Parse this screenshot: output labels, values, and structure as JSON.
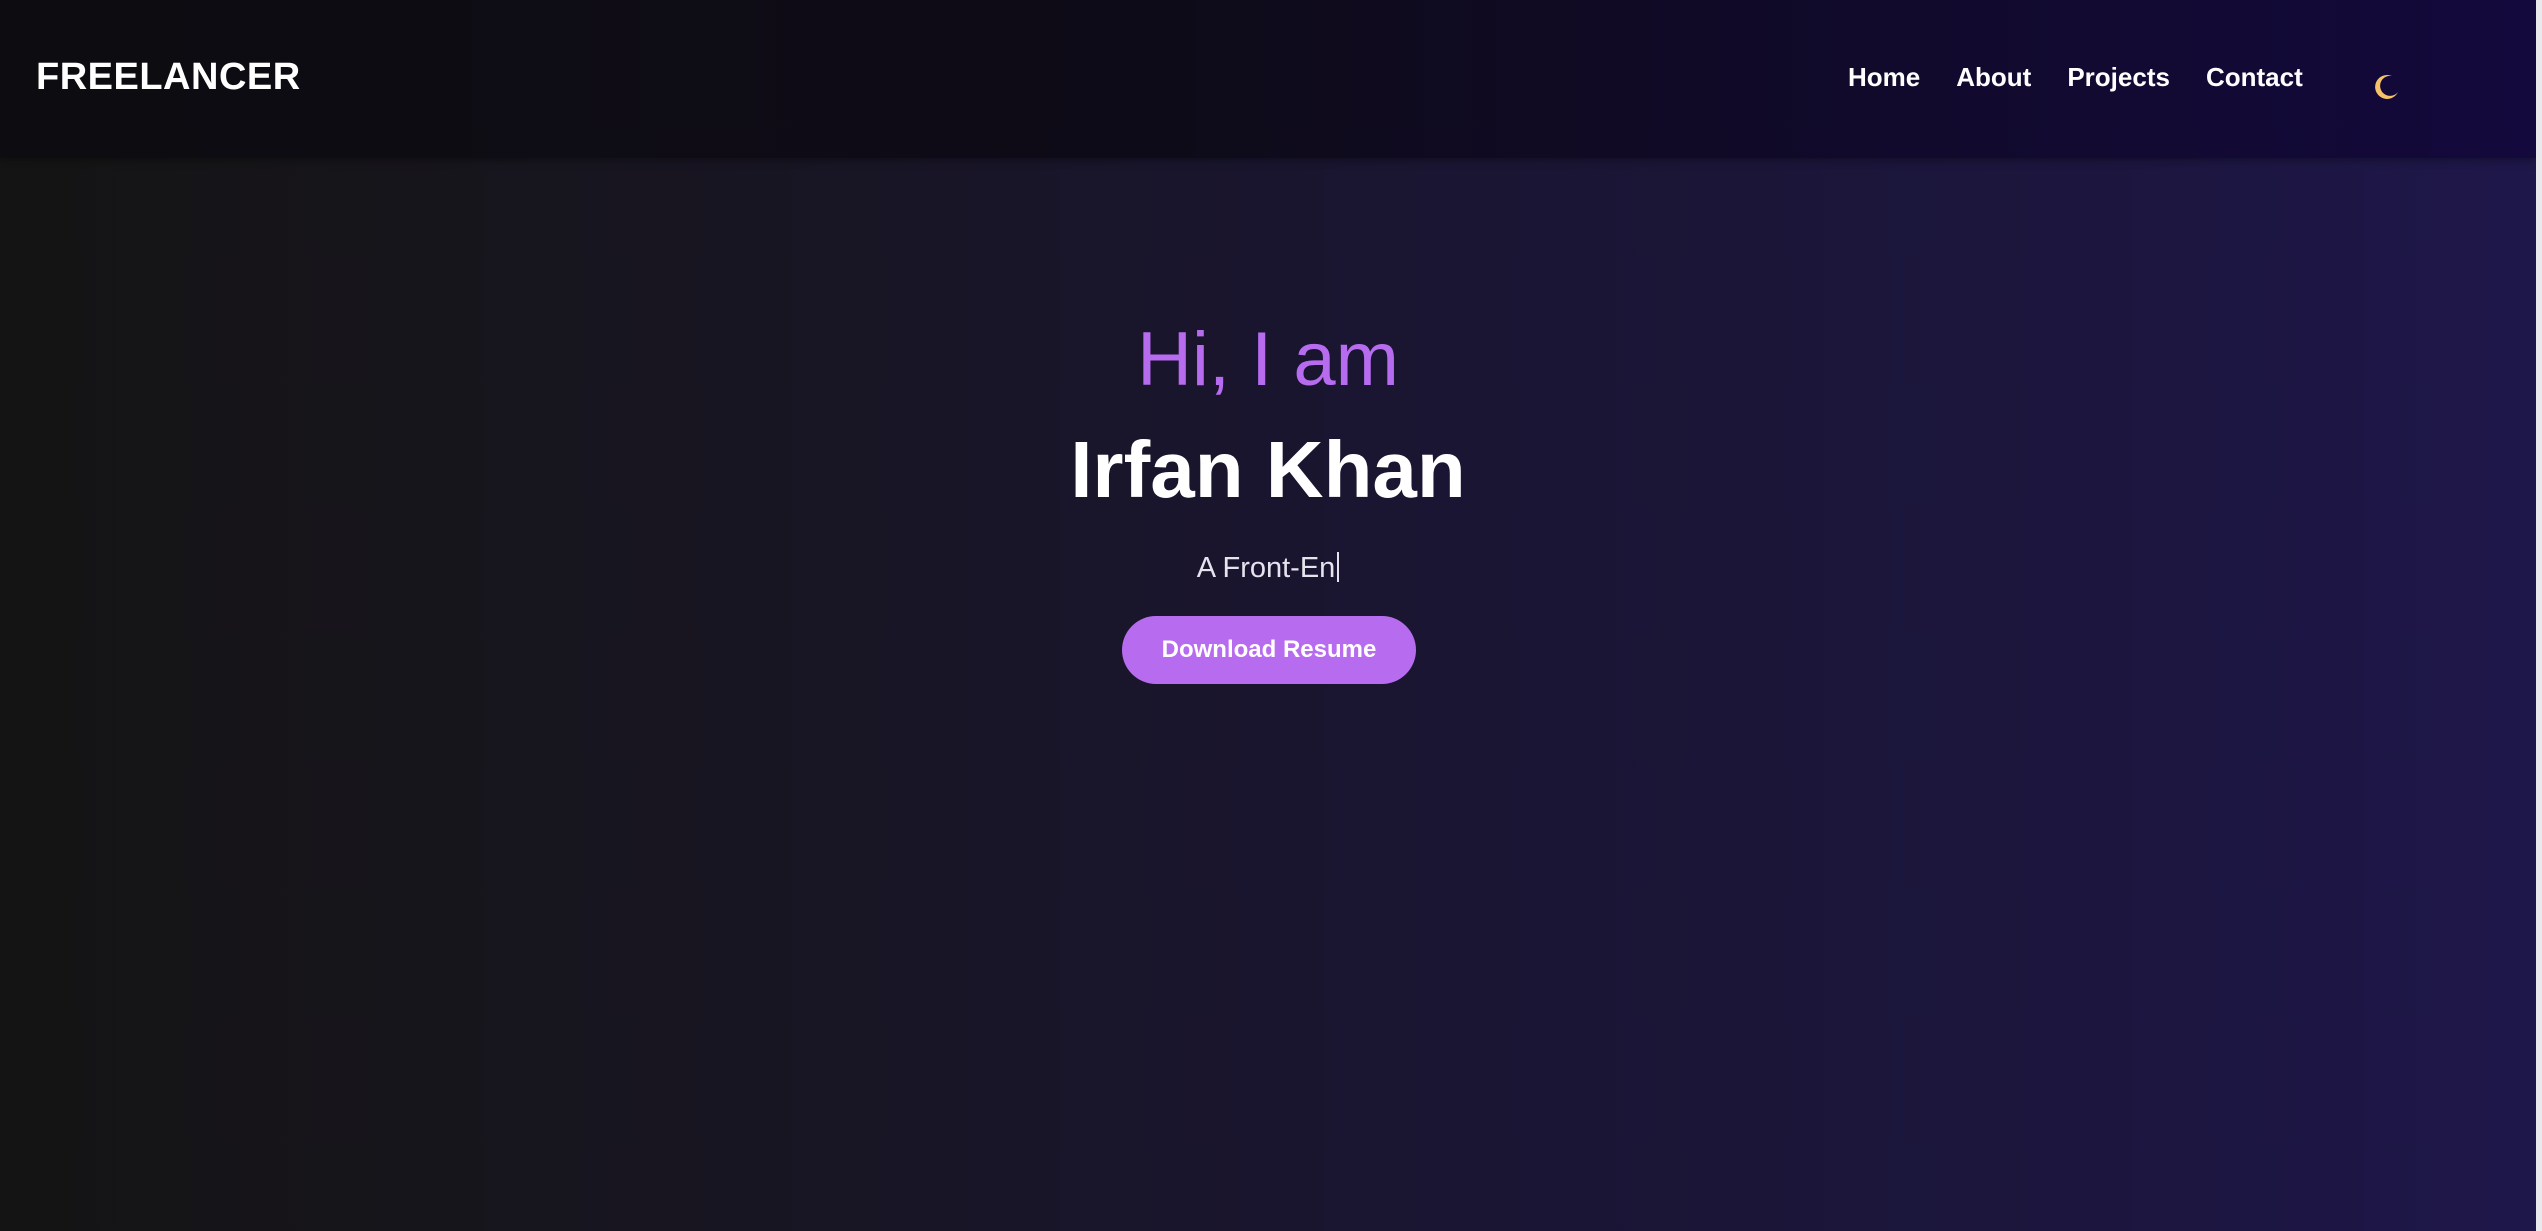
{
  "navbar": {
    "brand": "FREELANCER",
    "links": [
      {
        "label": "Home"
      },
      {
        "label": "About"
      },
      {
        "label": "Projects"
      },
      {
        "label": "Contact"
      }
    ],
    "theme_toggle_icon": "moon-icon"
  },
  "hero": {
    "greeting": "Hi, I am",
    "name": "Irfan Khan",
    "role_typed": "A Front-En",
    "resume_button": "Download Resume"
  },
  "colors": {
    "accent": "#b76cf0",
    "text_primary": "#ffffff",
    "moon": "#f5c26b"
  }
}
